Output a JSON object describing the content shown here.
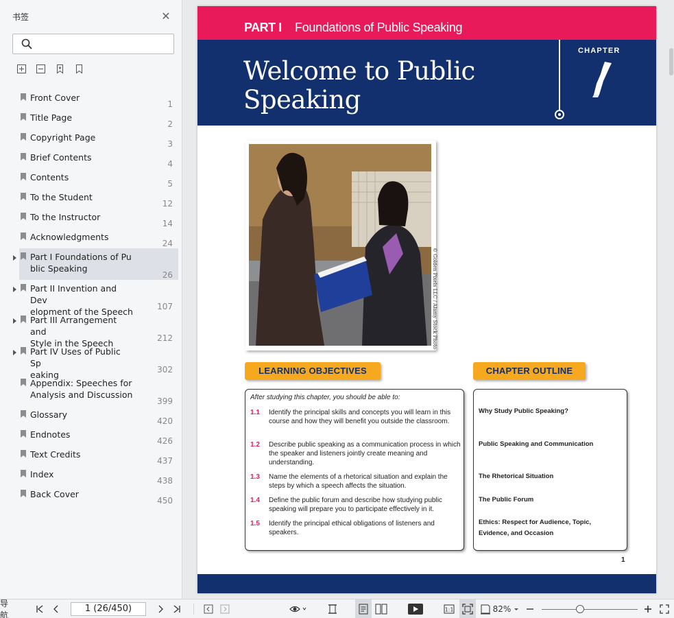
{
  "sidebar": {
    "title": "书签",
    "search_placeholder": "",
    "items": [
      {
        "label": "Front Cover",
        "page": "1",
        "expandable": false
      },
      {
        "label": "Title Page",
        "page": "2",
        "expandable": false
      },
      {
        "label": "Copyright Page",
        "page": "3",
        "expandable": false
      },
      {
        "label": "Brief Contents",
        "page": "4",
        "expandable": false
      },
      {
        "label": "Contents",
        "page": "5",
        "expandable": false
      },
      {
        "label": "To the Student",
        "page": "12",
        "expandable": false
      },
      {
        "label": "To the Instructor",
        "page": "14",
        "expandable": false
      },
      {
        "label": "Acknowledgments",
        "page": "24",
        "expandable": false
      },
      {
        "label": "Part I Foundations of Pu\nblic Speaking",
        "page": "26",
        "expandable": true,
        "active": true
      },
      {
        "label": "Part II Invention and Dev\nelopment of the Speech",
        "page": "107",
        "expandable": true
      },
      {
        "label": "Part III Arrangement and\nStyle in the Speech",
        "page": "212",
        "expandable": true
      },
      {
        "label": "Part IV Uses of Public Sp\neaking",
        "page": "302",
        "expandable": true
      },
      {
        "label": "Appendix: Speeches for\nAnalysis and Discussion",
        "page": "399",
        "expandable": false
      },
      {
        "label": "Glossary",
        "page": "420",
        "expandable": false
      },
      {
        "label": "Endnotes",
        "page": "426",
        "expandable": false
      },
      {
        "label": "Text Credits",
        "page": "437",
        "expandable": false
      },
      {
        "label": "Index",
        "page": "438",
        "expandable": false
      },
      {
        "label": "Back Cover",
        "page": "450",
        "expandable": false
      }
    ]
  },
  "page": {
    "part_label": "PART I",
    "part_title": "Foundations of Public Speaking",
    "chapter_title": "Welcome to Public Speaking",
    "chapter_word": "CHAPTER",
    "photo_credit": "© Golden Pixels LLC / Alamy Stock Photo",
    "learning_objectives_heading": "LEARNING OBJECTIVES",
    "chapter_outline_heading": "CHAPTER OUTLINE",
    "objectives_intro": "After studying this chapter, you should be able to:",
    "objectives": [
      {
        "num": "1.1",
        "text": "Identify the principal skills and concepts you will learn in this course and how they will benefit you outside the classroom."
      },
      {
        "num": "1.2",
        "text": "Describe public speaking as a communication process in which the speaker and listeners jointly create meaning and understanding."
      },
      {
        "num": "1.3",
        "text": "Name the elements of a rhetorical situation and explain the steps by which a speech affects the situation."
      },
      {
        "num": "1.4",
        "text": "Define the public forum and describe how studying public speaking will prepare you to participate effectively in it."
      },
      {
        "num": "1.5",
        "text": "Identify the principal ethical obligations of listeners and speakers."
      }
    ],
    "outline": [
      "Why Study Public Speaking?",
      "Public Speaking and Communication",
      "The Rhetorical Situation",
      "The Public Forum",
      "Ethics: Respect for Audience, Topic, Evidence, and Occasion"
    ],
    "page_number": "1",
    "colors": {
      "part_bar": "#e81a5a",
      "title_band": "#12306e",
      "tab": "#f6a81f"
    }
  },
  "toolbar": {
    "nav_label": "导航",
    "page_indicator": "1 (26/450)",
    "zoom": "82%"
  }
}
